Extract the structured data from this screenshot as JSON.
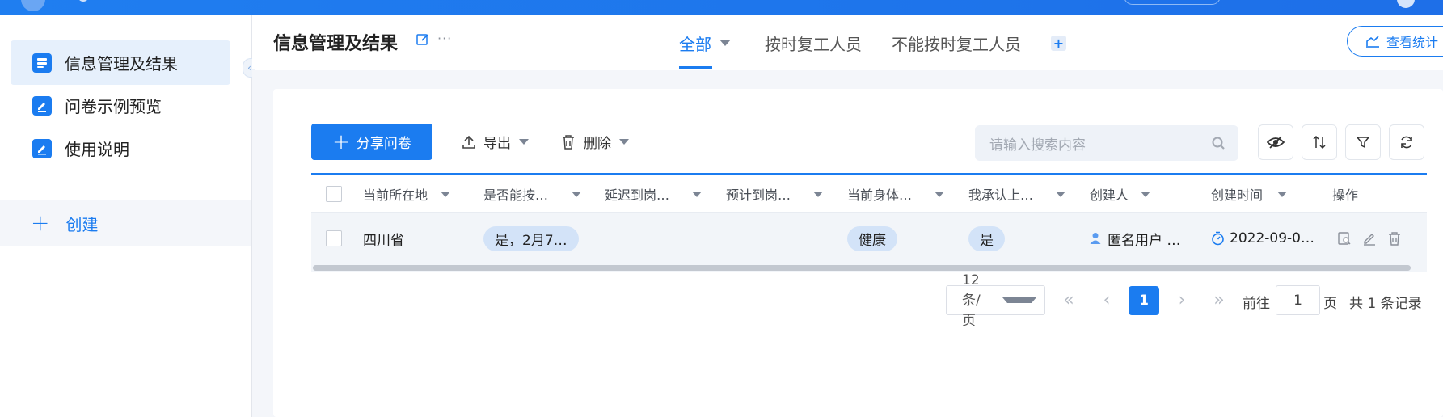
{
  "sidebar": {
    "items": [
      {
        "label": "信息管理及结果",
        "icon": "form-icon",
        "active": true
      },
      {
        "label": "问卷示例预览",
        "icon": "edit-doc-icon",
        "active": false
      },
      {
        "label": "使用说明",
        "icon": "edit-doc-icon",
        "active": false
      }
    ],
    "create_label": "创建"
  },
  "header": {
    "title": "信息管理及结果",
    "tabs": [
      {
        "label": "全部",
        "active": true
      },
      {
        "label": "按时复工人员",
        "active": false
      },
      {
        "label": "不能按时复工人员",
        "active": false
      }
    ],
    "stats_button": "查看统计"
  },
  "toolbar": {
    "share_label": "分享问卷",
    "export_label": "导出",
    "delete_label": "删除",
    "search_placeholder": "请输入搜索内容"
  },
  "table": {
    "columns": [
      "当前所在地",
      "是否能按…",
      "延迟到岗…",
      "预计到岗…",
      "当前身体…",
      "我承认上…",
      "创建人",
      "创建时间",
      "操作"
    ],
    "rows": [
      {
        "location": "四川省",
        "on_time": "是，2月7…",
        "delay": "",
        "expected": "",
        "health": "健康",
        "acknowledge": "是",
        "creator": "匿名用户 …",
        "created_at": "2022-09-0…"
      }
    ]
  },
  "pagination": {
    "page_size": "12条/页",
    "current_page": "1",
    "goto_prefix": "前往",
    "goto_value": "1",
    "goto_suffix": "页",
    "total": "共 1 条记录"
  },
  "colors": {
    "primary": "#1b7cf0",
    "sidebar_active_bg": "#e6f0fc",
    "content_bg": "#f4f6fa",
    "tag_bg": "#d3e3f8"
  }
}
